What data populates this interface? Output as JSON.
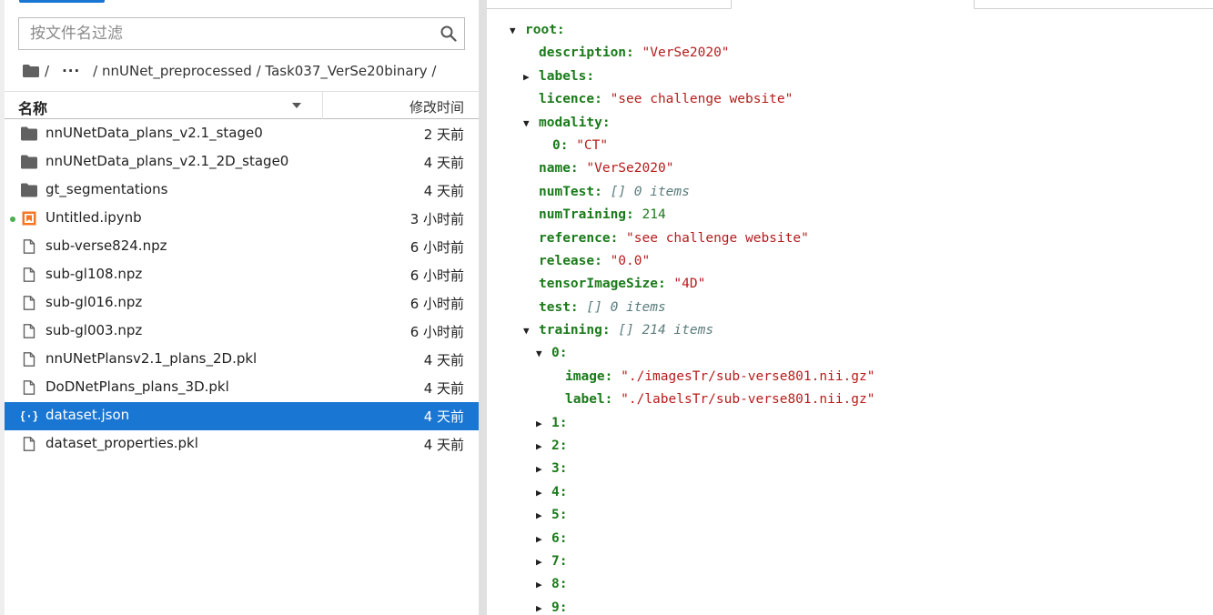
{
  "search": {
    "placeholder": "按文件名过滤"
  },
  "breadcrumbs": {
    "sep1": "/",
    "ellipsis": "···",
    "path": "/ nnUNet_preprocessed / Task037_VerSe20binary /"
  },
  "list_header": {
    "name": "名称",
    "modified": "修改时间"
  },
  "files": [
    {
      "name": "nnUNetData_plans_v2.1_stage0",
      "time": "2 天前",
      "icon": "folder-icon"
    },
    {
      "name": "nnUNetData_plans_v2.1_2D_stage0",
      "time": "4 天前",
      "icon": "folder-icon"
    },
    {
      "name": "gt_segmentations",
      "time": "4 天前",
      "icon": "folder-icon"
    },
    {
      "name": "Untitled.ipynb",
      "time": "3 小时前",
      "icon": "notebook-icon"
    },
    {
      "name": "sub-verse824.npz",
      "time": "6 小时前",
      "icon": "file-icon"
    },
    {
      "name": "sub-gl108.npz",
      "time": "6 小时前",
      "icon": "file-icon"
    },
    {
      "name": "sub-gl016.npz",
      "time": "6 小时前",
      "icon": "file-icon"
    },
    {
      "name": "sub-gl003.npz",
      "time": "6 小时前",
      "icon": "file-icon"
    },
    {
      "name": "nnUNetPlansv2.1_plans_2D.pkl",
      "time": "4 天前",
      "icon": "file-icon"
    },
    {
      "name": "DoDNetPlans_plans_3D.pkl",
      "time": "4 天前",
      "icon": "file-icon"
    },
    {
      "name": "dataset.json",
      "time": "4 天前",
      "icon": "json-icon"
    },
    {
      "name": "dataset_properties.pkl",
      "time": "4 天前",
      "icon": "file-icon"
    }
  ],
  "json": {
    "root_key": "root:",
    "description_key": "description:",
    "description_val": "\"VerSe2020\"",
    "labels_key": "labels:",
    "licence_key": "licence:",
    "licence_val": "\"see challenge website\"",
    "modality_key": "modality:",
    "modality_0_key": "0:",
    "modality_0_val": "\"CT\"",
    "name_key": "name:",
    "name_val": "\"VerSe2020\"",
    "numTest_key": "numTest:",
    "numTest_meta": "[] 0 items",
    "numTraining_key": "numTraining:",
    "numTraining_val": "214",
    "reference_key": "reference:",
    "reference_val": "\"see challenge website\"",
    "release_key": "release:",
    "release_val": "\"0.0\"",
    "tensorImageSize_key": "tensorImageSize:",
    "tensorImageSize_val": "\"4D\"",
    "test_key": "test:",
    "test_meta": "[] 0 items",
    "training_key": "training:",
    "training_meta": "[] 214 items",
    "training_0_key": "0:",
    "image_key": "image:",
    "image_val": "\"./imagesTr/sub-verse801.nii.gz\"",
    "label_key": "label:",
    "label_val": "\"./labelsTr/sub-verse801.nii.gz\"",
    "collapsed": [
      "1:",
      "2:",
      "3:",
      "4:",
      "5:",
      "6:",
      "7:",
      "8:",
      "9:"
    ]
  }
}
